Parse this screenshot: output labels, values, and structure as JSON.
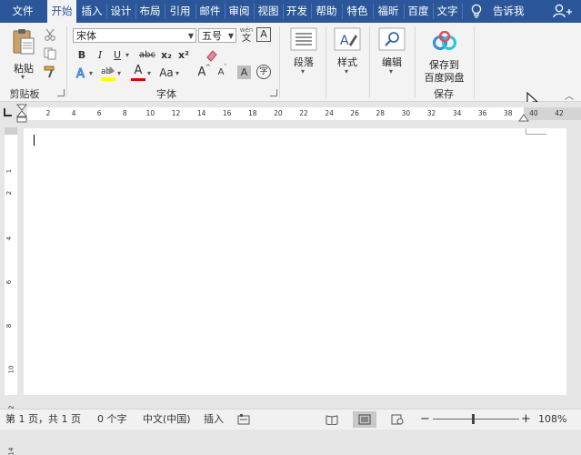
{
  "tabs": [
    {
      "label": "文件"
    },
    {
      "label": "开始"
    },
    {
      "label": "插入"
    },
    {
      "label": "设计"
    },
    {
      "label": "布局"
    },
    {
      "label": "引用"
    },
    {
      "label": "邮件"
    },
    {
      "label": "审阅"
    },
    {
      "label": "视图"
    },
    {
      "label": "开发"
    },
    {
      "label": "帮助"
    },
    {
      "label": "特色"
    },
    {
      "label": "福昕"
    },
    {
      "label": "百度"
    },
    {
      "label": "文字"
    }
  ],
  "tell_me": "告诉我",
  "clipboard": {
    "paste_label": "粘贴",
    "group_label": "剪贴板",
    "cut_icon": "scissors-icon",
    "copy_icon": "copy-icon",
    "format_painter_icon": "format-painter-icon"
  },
  "font": {
    "font_name": "宋体",
    "font_size": "五号",
    "group_label": "字体",
    "bold": "B",
    "italic": "I",
    "underline": "U",
    "strikethrough": "abc",
    "subscript": "x₂",
    "superscript": "x²",
    "font_color_a": "A",
    "change_case": "Aa",
    "grow_font": "A",
    "shrink_font": "A",
    "char_border": "A",
    "char_shading": "A",
    "enclose_char": "字",
    "phonetic_top": "wén",
    "phonetic_bottom": "文"
  },
  "paragraph": {
    "label": "段落"
  },
  "styles": {
    "label": "样式"
  },
  "editing": {
    "label": "编辑"
  },
  "save": {
    "line1": "保存到",
    "line2": "百度网盘",
    "group_label": "保存"
  },
  "ruler": {
    "marks": [
      "2",
      "4",
      "6",
      "8",
      "10",
      "12",
      "14",
      "16",
      "18",
      "20",
      "22",
      "24",
      "26",
      "28",
      "30",
      "32",
      "34",
      "36",
      "38",
      "40",
      "42"
    ]
  },
  "vruler": {
    "marks": [
      "1",
      "2",
      "4",
      "6",
      "8",
      "10",
      "12",
      "14"
    ]
  },
  "status": {
    "page": "第 1 页，共 1 页",
    "words": "0 个字",
    "language": "中文(中国)",
    "mode": "插入",
    "zoom": "108%",
    "zoom_minus": "−",
    "zoom_plus": "+"
  },
  "colors": {
    "accent": "#2b579a",
    "highlight": "#ffff00",
    "font_color": "#e00000"
  }
}
